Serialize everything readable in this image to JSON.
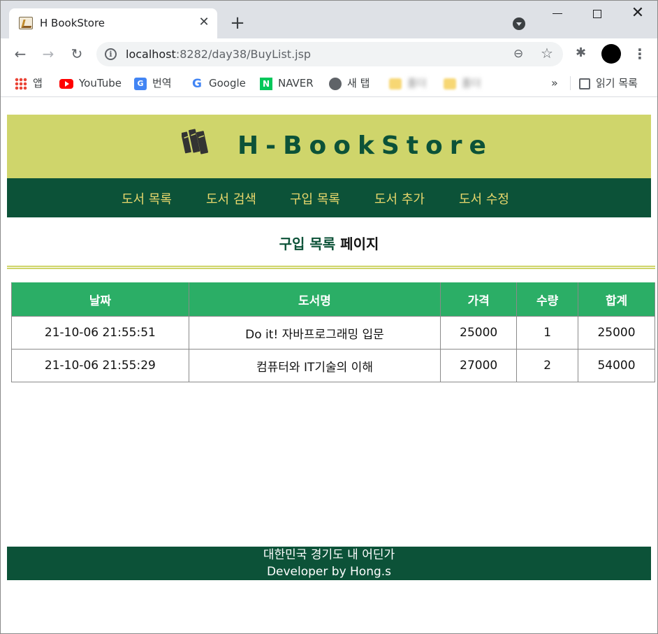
{
  "browser": {
    "tab_title": "H BookStore",
    "tab_close_glyph": "✕",
    "new_tab_glyph": "+",
    "url_host": "localhost",
    "url_path": ":8282/day38/BuyList.jsp",
    "nav": {
      "back_glyph": "←",
      "forward_glyph": "→",
      "reload_glyph": "↻"
    },
    "window": {
      "close_glyph": "✕"
    },
    "menu_glyph": "⋮",
    "bookmarks": [
      {
        "label": "앱",
        "icon": "apps-icon"
      },
      {
        "label": "YouTube",
        "icon": "youtube-icon"
      },
      {
        "label": "번역",
        "icon": "translate-icon"
      },
      {
        "label": "Google",
        "icon": "google-icon"
      },
      {
        "label": "NAVER",
        "icon": "naver-icon"
      },
      {
        "label": "새 탭",
        "icon": "globe-icon"
      },
      {
        "label": "",
        "icon": "folder-icon"
      },
      {
        "label": "",
        "icon": "folder-icon"
      }
    ],
    "more_glyph": "»",
    "reading_list": "읽기 목록"
  },
  "site": {
    "title": "H-BookStore",
    "logo_icon": "books-icon",
    "colors": {
      "header": "#cfd56b",
      "nav": "#0c5238",
      "nav_text": "#e8d76c",
      "table_head": "#2bae66"
    },
    "nav_items": [
      "도서 목록",
      "도서 검색",
      "구입 목록",
      "도서 추가",
      "도서 수정"
    ],
    "heading_main": "구입 목록",
    "heading_suffix": "페이지",
    "table": {
      "headers": [
        "날짜",
        "도서명",
        "가격",
        "수량",
        "합계"
      ],
      "rows": [
        [
          "21-10-06 21:55:51",
          "Do it! 자바프로그래밍 입문",
          "25000",
          "1",
          "25000"
        ],
        [
          "21-10-06 21:55:29",
          "컴퓨터와 IT기술의 이해",
          "27000",
          "2",
          "54000"
        ]
      ]
    },
    "footer": {
      "line1": "대한민국 경기도 내 어딘가",
      "line2": "Developer by Hong.s"
    }
  }
}
